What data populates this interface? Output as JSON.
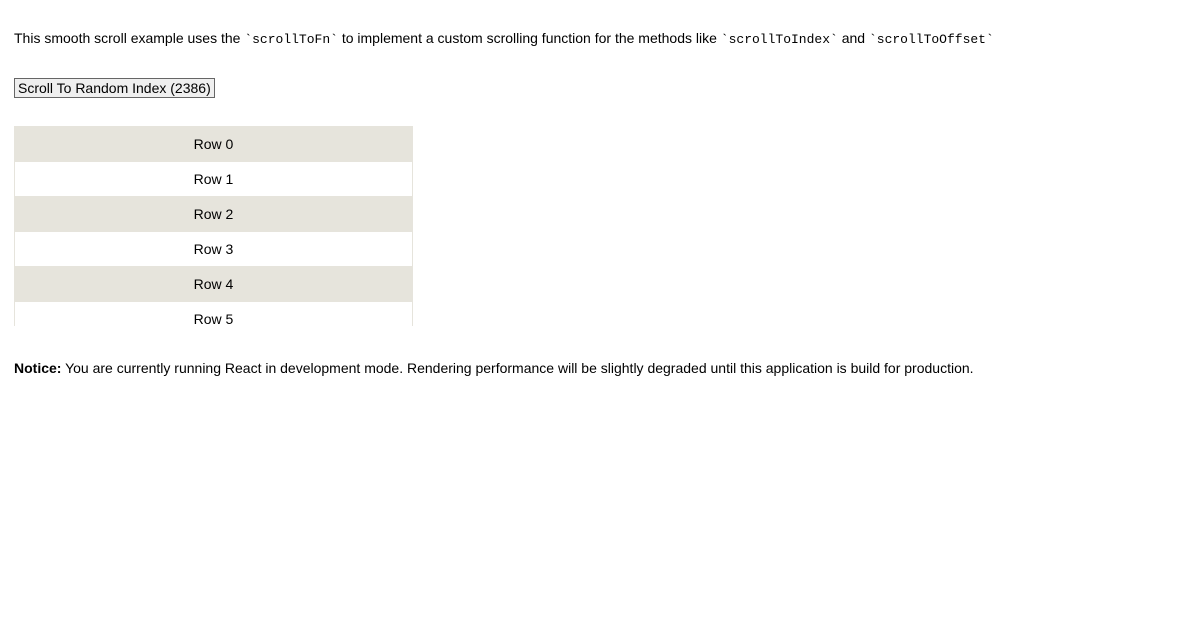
{
  "description": {
    "part1": "This smooth scroll example uses the ",
    "code1": "`scrollToFn`",
    "part2": " to implement a custom scrolling function for the methods like ",
    "code2": "`scrollToIndex`",
    "part3": " and ",
    "code3": "`scrollToOffset`"
  },
  "button": {
    "label": "Scroll To Random Index (2386)"
  },
  "rows": [
    {
      "label": "Row 0"
    },
    {
      "label": "Row 1"
    },
    {
      "label": "Row 2"
    },
    {
      "label": "Row 3"
    },
    {
      "label": "Row 4"
    },
    {
      "label": "Row 5"
    }
  ],
  "notice": {
    "label": "Notice:",
    "text": " You are currently running React in development mode. Rendering performance will be slightly degraded until this application is build for production."
  }
}
